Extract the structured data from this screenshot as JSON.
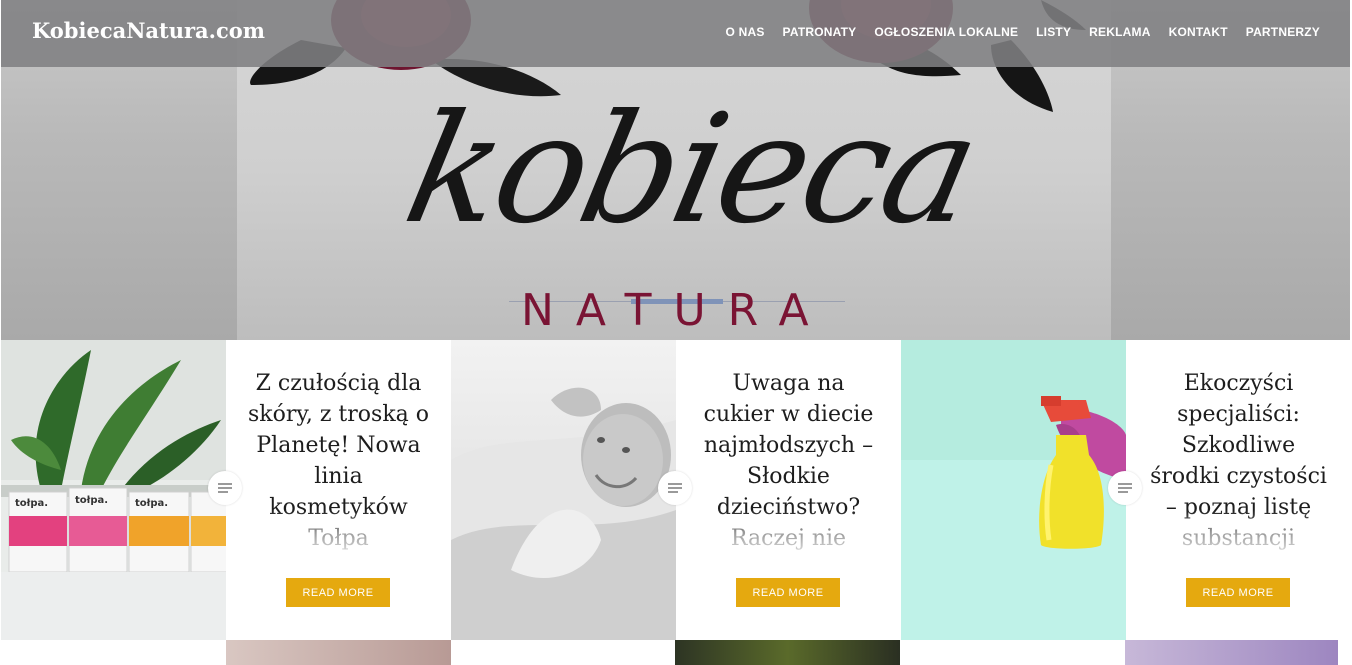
{
  "header": {
    "site_title": "KobiecaNatura.com",
    "nav": [
      "O NAS",
      "PATRONATY",
      "OGŁOSZENIA LOKALNE",
      "LISTY",
      "REKLAMA",
      "KONTAKT",
      "PARTNERZY"
    ]
  },
  "hero": {
    "logo_script": "kobieca",
    "logo_word": "NATURA"
  },
  "posts": [
    {
      "title": "Z czułością dla skóry, z troską o Planetę! Nowa linia kosmetyków Tołpa",
      "read_more": "READ MORE",
      "image_icon": "cosmetics-photo",
      "brand_label": "tołpa."
    },
    {
      "title": "Uwaga na cukier w diecie najmłodszych – Słodkie dzieciństwo? Raczej nie",
      "read_more": "READ MORE",
      "image_icon": "baby-photo"
    },
    {
      "title": "Ekoczyści specjaliści: Szkodliwe środki czystości – poznaj listę substancji",
      "read_more": "READ MORE",
      "image_icon": "spray-bottle-photo"
    }
  ],
  "colors": {
    "header_bg": "#808082",
    "accent": "#e5a90f",
    "natura": "#7a1434",
    "mint": "#b8f1e6"
  }
}
